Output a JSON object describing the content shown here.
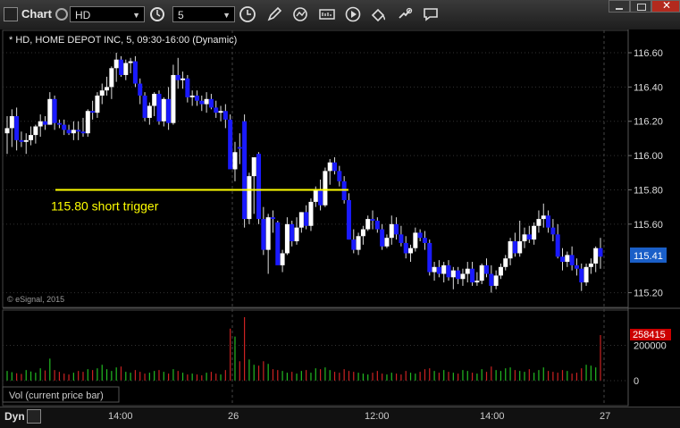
{
  "toolbar": {
    "title": "Chart",
    "symbol": "HD",
    "interval": "5",
    "icons": [
      "clock-settings-icon",
      "clock-icon",
      "pencil-icon",
      "cursor-icon",
      "chart-config-icon",
      "play-icon",
      "fill-icon",
      "comment-icon"
    ]
  },
  "chart": {
    "header": "* HD, HOME DEPOT INC, 5, 09:30-16:00 (Dynamic)",
    "copyright": "© eSignal, 2015",
    "last_price": "115.41",
    "annotation": "115.80 short trigger",
    "price_ticks": [
      "116.60",
      "116.40",
      "116.20",
      "116.00",
      "115.80",
      "115.60",
      "115.20"
    ],
    "vol_label": "Vol (current price bar)",
    "vol_last": "258415",
    "vol_ticks": [
      "200000",
      "0"
    ]
  },
  "status": {
    "dyn": "Dyn",
    "time_ticks": [
      "14:00",
      "26",
      "12:00",
      "14:00",
      "27"
    ]
  },
  "colors": {
    "up": "#ffffff",
    "down": "#1a1aff",
    "trigger": "#ffff00",
    "vol_up": "#22bb22",
    "vol_down": "#cc2222",
    "badge": "#1a5fc8",
    "vol_badge": "#cc0000"
  },
  "chart_data": {
    "type": "candlestick",
    "ylim": [
      115.13,
      116.72
    ],
    "trigger_level": 115.8,
    "bars": [
      [
        116.13,
        116.23,
        116.01,
        116.16
      ],
      [
        116.16,
        116.27,
        116.05,
        116.23
      ],
      [
        116.23,
        116.28,
        116.03,
        116.09
      ],
      [
        116.09,
        116.14,
        116.05,
        116.08
      ],
      [
        116.08,
        116.13,
        116.01,
        116.09
      ],
      [
        116.09,
        116.17,
        116.06,
        116.12
      ],
      [
        116.12,
        116.18,
        116.07,
        116.17
      ],
      [
        116.17,
        116.24,
        116.11,
        116.2
      ],
      [
        116.2,
        116.23,
        116.15,
        116.18
      ],
      [
        116.18,
        116.37,
        116.18,
        116.33
      ],
      [
        116.33,
        116.35,
        116.15,
        116.19
      ],
      [
        116.19,
        116.21,
        116.16,
        116.18
      ],
      [
        116.18,
        116.21,
        116.12,
        116.15
      ],
      [
        116.15,
        116.18,
        116.12,
        116.13
      ],
      [
        116.13,
        116.2,
        116.09,
        116.15
      ],
      [
        116.15,
        116.2,
        116.09,
        116.14
      ],
      [
        116.14,
        116.22,
        116.11,
        116.13
      ],
      [
        116.13,
        116.27,
        116.11,
        116.26
      ],
      [
        116.26,
        116.32,
        116.21,
        116.25
      ],
      [
        116.25,
        116.37,
        116.22,
        116.35
      ],
      [
        116.35,
        116.42,
        116.3,
        116.38
      ],
      [
        116.38,
        116.46,
        116.35,
        116.4
      ],
      [
        116.4,
        116.52,
        116.33,
        116.51
      ],
      [
        116.51,
        116.6,
        116.43,
        116.56
      ],
      [
        116.56,
        116.58,
        116.46,
        116.47
      ],
      [
        116.47,
        116.56,
        116.44,
        116.54
      ],
      [
        116.54,
        116.57,
        116.48,
        116.55
      ],
      [
        116.55,
        116.58,
        116.4,
        116.42
      ],
      [
        116.42,
        116.45,
        116.3,
        116.35
      ],
      [
        116.35,
        116.37,
        116.2,
        116.22
      ],
      [
        116.22,
        116.31,
        116.18,
        116.29
      ],
      [
        116.29,
        116.37,
        116.23,
        116.36
      ],
      [
        116.36,
        116.38,
        116.18,
        116.2
      ],
      [
        116.2,
        116.34,
        116.17,
        116.33
      ],
      [
        116.33,
        116.4,
        116.15,
        116.19
      ],
      [
        116.19,
        116.53,
        116.18,
        116.47
      ],
      [
        116.47,
        116.57,
        116.39,
        116.44
      ],
      [
        116.44,
        116.49,
        116.39,
        116.45
      ],
      [
        116.45,
        116.47,
        116.31,
        116.34
      ],
      [
        116.34,
        116.38,
        116.29,
        116.35
      ],
      [
        116.35,
        116.38,
        116.29,
        116.32
      ],
      [
        116.32,
        116.35,
        116.26,
        116.3
      ],
      [
        116.3,
        116.37,
        116.25,
        116.33
      ],
      [
        116.33,
        116.36,
        116.27,
        116.28
      ],
      [
        116.28,
        116.32,
        116.22,
        116.25
      ],
      [
        116.25,
        116.29,
        116.2,
        116.26
      ],
      [
        116.26,
        116.3,
        116.16,
        116.21
      ],
      [
        116.21,
        116.24,
        115.93,
        115.92
      ],
      [
        115.92,
        116.08,
        115.85,
        116.02
      ],
      [
        116.05,
        116.13,
        115.95,
        116.04
      ],
      [
        116.2,
        116.24,
        115.58,
        115.63
      ],
      [
        115.63,
        115.9,
        115.6,
        115.88
      ],
      [
        115.88,
        115.94,
        115.66,
        115.99
      ],
      [
        116.01,
        116.02,
        115.6,
        115.63
      ],
      [
        115.63,
        115.7,
        115.42,
        115.45
      ],
      [
        115.45,
        115.66,
        115.31,
        115.64
      ],
      [
        115.64,
        115.68,
        115.55,
        115.63
      ],
      [
        115.61,
        115.62,
        115.4,
        115.36
      ],
      [
        115.36,
        115.45,
        115.32,
        115.43
      ],
      [
        115.43,
        115.64,
        115.42,
        115.6
      ],
      [
        115.6,
        115.62,
        115.47,
        115.5
      ],
      [
        115.5,
        115.64,
        115.48,
        115.58
      ],
      [
        115.58,
        115.67,
        115.55,
        115.67
      ],
      [
        115.67,
        115.71,
        115.57,
        115.59
      ],
      [
        115.59,
        115.75,
        115.56,
        115.73
      ],
      [
        115.73,
        115.82,
        115.7,
        115.8
      ],
      [
        115.8,
        115.86,
        115.68,
        115.71
      ],
      [
        115.71,
        115.93,
        115.7,
        115.91
      ],
      [
        115.91,
        115.98,
        115.83,
        115.96
      ],
      [
        115.96,
        115.99,
        115.89,
        115.91
      ],
      [
        115.91,
        115.94,
        115.82,
        115.85
      ],
      [
        115.85,
        115.88,
        115.72,
        115.74
      ],
      [
        115.74,
        115.78,
        115.51,
        115.51
      ],
      [
        115.51,
        115.57,
        115.43,
        115.45
      ],
      [
        115.45,
        115.55,
        115.42,
        115.53
      ],
      [
        115.53,
        115.59,
        115.48,
        115.57
      ],
      [
        115.57,
        115.65,
        115.56,
        115.63
      ],
      [
        115.63,
        115.68,
        115.57,
        115.62
      ],
      [
        115.62,
        115.64,
        115.55,
        115.57
      ],
      [
        115.57,
        115.6,
        115.45,
        115.47
      ],
      [
        115.47,
        115.54,
        115.46,
        115.52
      ],
      [
        115.52,
        115.65,
        115.48,
        115.6
      ],
      [
        115.6,
        115.64,
        115.51,
        115.54
      ],
      [
        115.54,
        115.59,
        115.47,
        115.49
      ],
      [
        115.49,
        115.53,
        115.4,
        115.43
      ],
      [
        115.43,
        115.48,
        115.38,
        115.46
      ],
      [
        115.46,
        115.58,
        115.44,
        115.55
      ],
      [
        115.55,
        115.57,
        115.5,
        115.52
      ],
      [
        115.52,
        115.56,
        115.45,
        115.49
      ],
      [
        115.49,
        115.51,
        115.3,
        115.32
      ],
      [
        115.32,
        115.38,
        115.27,
        115.35
      ],
      [
        115.35,
        115.39,
        115.29,
        115.31
      ],
      [
        115.31,
        115.38,
        115.26,
        115.36
      ],
      [
        115.36,
        115.39,
        115.27,
        115.29
      ],
      [
        115.29,
        115.35,
        115.22,
        115.33
      ],
      [
        115.33,
        115.35,
        115.25,
        115.28
      ],
      [
        115.28,
        115.34,
        115.24,
        115.31
      ],
      [
        115.31,
        115.38,
        115.26,
        115.34
      ],
      [
        115.34,
        115.38,
        115.24,
        115.26
      ],
      [
        115.26,
        115.32,
        115.24,
        115.27
      ],
      [
        115.27,
        115.37,
        115.25,
        115.36
      ],
      [
        115.36,
        115.4,
        115.29,
        115.31
      ],
      [
        115.31,
        115.36,
        115.2,
        115.24
      ],
      [
        115.24,
        115.33,
        115.22,
        115.3
      ],
      [
        115.3,
        115.37,
        115.28,
        115.35
      ],
      [
        115.35,
        115.42,
        115.33,
        115.4
      ],
      [
        115.4,
        115.52,
        115.36,
        115.5
      ],
      [
        115.5,
        115.55,
        115.41,
        115.43
      ],
      [
        115.43,
        115.62,
        115.41,
        115.5
      ],
      [
        115.5,
        115.58,
        115.46,
        115.54
      ],
      [
        115.54,
        115.59,
        115.49,
        115.51
      ],
      [
        115.51,
        115.61,
        115.48,
        115.59
      ],
      [
        115.59,
        115.68,
        115.55,
        115.63
      ],
      [
        115.63,
        115.72,
        115.58,
        115.65
      ],
      [
        115.65,
        115.68,
        115.55,
        115.58
      ],
      [
        115.58,
        115.63,
        115.5,
        115.54
      ],
      [
        115.54,
        115.6,
        115.4,
        115.41
      ],
      [
        115.41,
        115.46,
        115.33,
        115.38
      ],
      [
        115.38,
        115.44,
        115.35,
        115.42
      ],
      [
        115.42,
        115.47,
        115.33,
        115.36
      ],
      [
        115.36,
        115.4,
        115.3,
        115.34
      ],
      [
        115.34,
        115.37,
        115.21,
        115.26
      ],
      [
        115.26,
        115.37,
        115.24,
        115.35
      ],
      [
        115.35,
        115.4,
        115.31,
        115.37
      ],
      [
        115.37,
        115.47,
        115.32,
        115.46
      ],
      [
        115.46,
        115.52,
        115.34,
        115.41
      ]
    ],
    "volume": [
      55000,
      48000,
      42000,
      38000,
      60000,
      52000,
      45000,
      70000,
      58000,
      125000,
      60000,
      50000,
      40000,
      35000,
      45000,
      55000,
      50000,
      65000,
      60000,
      70000,
      90000,
      65000,
      55000,
      75000,
      80000,
      50000,
      45000,
      60000,
      50000,
      40000,
      45000,
      55000,
      60000,
      50000,
      40000,
      65000,
      55000,
      45000,
      35000,
      40000,
      35000,
      30000,
      45000,
      50000,
      40000,
      35000,
      60000,
      295000,
      250000,
      110000,
      360000,
      120000,
      90000,
      85000,
      110000,
      95000,
      65000,
      60000,
      55000,
      45000,
      50000,
      40000,
      55000,
      60000,
      45000,
      70000,
      65000,
      75000,
      60000,
      50000,
      45000,
      65000,
      55000,
      50000,
      45000,
      40000,
      35000,
      45000,
      55000,
      40000,
      35000,
      45000,
      40000,
      35000,
      55000,
      45000,
      40000,
      50000,
      65000,
      70000,
      55000,
      45000,
      60000,
      50000,
      45000,
      40000,
      60000,
      55000,
      45000,
      40000,
      65000,
      50000,
      80000,
      60000,
      55000,
      70000,
      75000,
      60000,
      55000,
      50000,
      65000,
      45000,
      60000,
      75000,
      55000,
      50000,
      45000,
      60000,
      55000,
      40000,
      45000,
      70000,
      90000,
      85000,
      75000,
      258415
    ]
  }
}
